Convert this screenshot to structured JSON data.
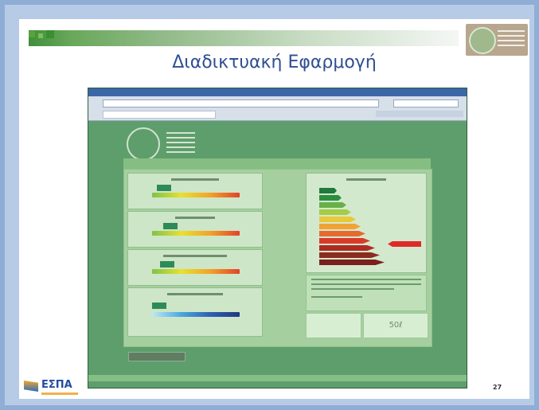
{
  "slide": {
    "title": "Διαδικτυακή Εφαρμογή",
    "page_number": "27",
    "footer_logo": "ΕΣΠΑ"
  },
  "app": {
    "value_label": "50ℓ"
  },
  "colors": {
    "accent_green": "#5e9e6c",
    "title_blue": "#2f4f92",
    "highlight_red": "#df2a2a"
  }
}
